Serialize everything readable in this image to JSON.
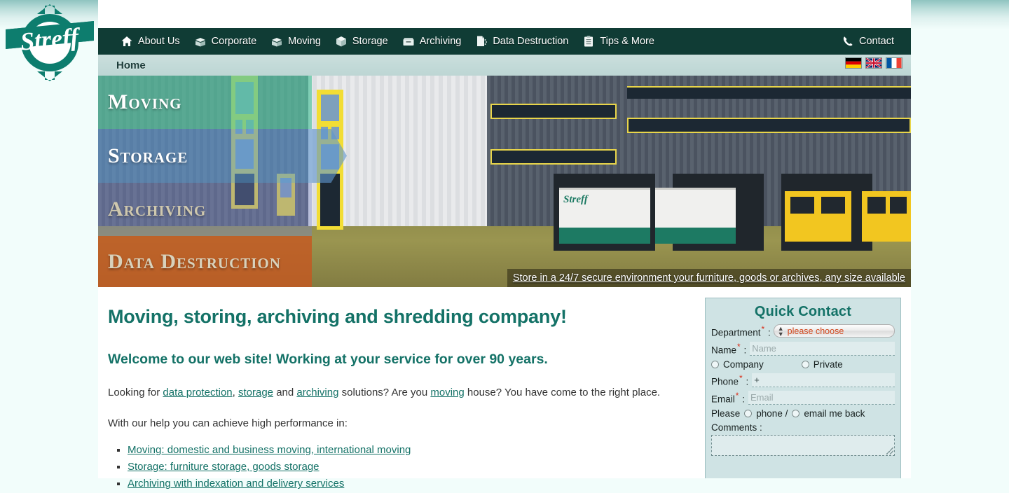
{
  "brand": {
    "name": "Streff",
    "logo_icon": "streff-compass-logo",
    "accent_color": "#147267",
    "nav_bg": "#103c35"
  },
  "nav": {
    "items": [
      {
        "label": "About Us",
        "icon": "home-icon"
      },
      {
        "label": "Corporate",
        "icon": "open-box-icon"
      },
      {
        "label": "Moving",
        "icon": "open-box-icon"
      },
      {
        "label": "Storage",
        "icon": "closed-box-icon"
      },
      {
        "label": "Archiving",
        "icon": "archive-box-icon"
      },
      {
        "label": "Data Destruction",
        "icon": "shredded-document-icon"
      },
      {
        "label": "Tips & More",
        "icon": "clipboard-icon"
      }
    ],
    "contact": {
      "label": "Contact",
      "icon": "phone-icon"
    }
  },
  "breadcrumb": {
    "label": "Home"
  },
  "languages": [
    {
      "name": "German",
      "code": "de"
    },
    {
      "name": "English",
      "code": "en"
    },
    {
      "name": "French",
      "code": "fr"
    }
  ],
  "hero": {
    "strips": [
      {
        "label": "Moving",
        "color": "#58c4a0"
      },
      {
        "label": "Storage",
        "color": "#6096cf"
      },
      {
        "label": "Archiving",
        "color": "#7682c4"
      },
      {
        "label": "Data Destruction",
        "color": "#c45821"
      }
    ],
    "caption": "Store in a 24/7 secure environment your furniture, goods or archives, any size available",
    "truck_label": "Streff"
  },
  "main": {
    "heading": "Moving, storing, archiving and shredding company!",
    "subheading": "Welcome to our web site! Working at your service for over 90 years.",
    "intro": {
      "part1": "Looking for ",
      "link1": "data protection",
      "part2": ", ",
      "link2": "storage",
      "part3": " and ",
      "link3": "archiving",
      "part4": " solutions? Are you ",
      "link4": "moving",
      "part5": " house? You have come to the right place."
    },
    "lead_in": "With our help you can achieve high performance in:",
    "bullets": [
      "Moving: domestic and business moving, international moving",
      "Storage: furniture storage, goods storage",
      "Archiving with indexation and delivery services"
    ]
  },
  "quick_contact": {
    "title": "Quick Contact",
    "department_label": "Department",
    "department_value": "please choose",
    "name_label": "Name",
    "name_placeholder": "Name",
    "name_value": "",
    "company_label": "Company",
    "private_label": "Private",
    "phone_label": "Phone",
    "phone_value": "+",
    "email_label": "Email",
    "email_placeholder": "Email",
    "email_value": "",
    "please_label": "Please",
    "phone_back_label": "phone /",
    "email_back_label": "email me back",
    "comments_label": "Comments :",
    "comments_value": "",
    "required_mark": "*",
    "colon": ":"
  }
}
